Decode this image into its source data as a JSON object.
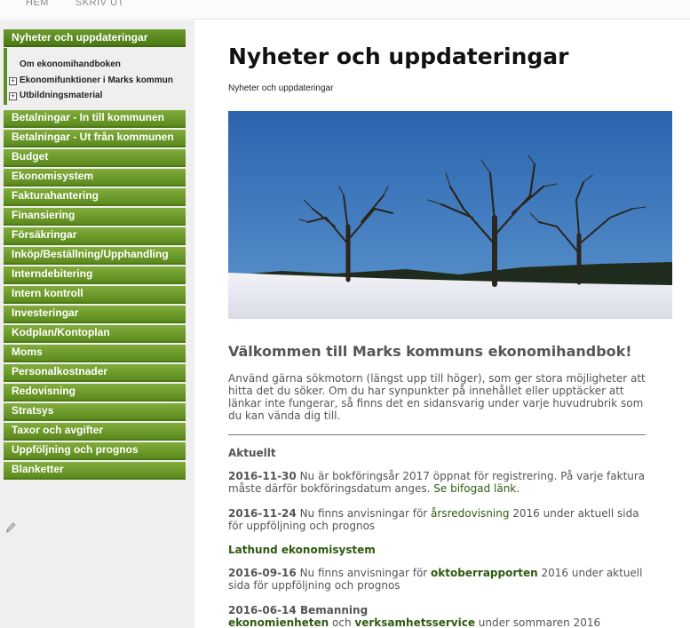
{
  "top_nav": {
    "home": "HEM",
    "print": "SKRIV UT"
  },
  "sidebar": {
    "active_section": "Nyheter och uppdateringar",
    "subitems": [
      {
        "label": "Om ekonomihandboken",
        "expandable": false
      },
      {
        "label": "Ekonomifunktioner i Marks kommun",
        "expandable": true
      },
      {
        "label": "Utbildningsmaterial",
        "expandable": true
      }
    ],
    "items": [
      "Betalningar - In till kommunen",
      "Betalningar - Ut från kommunen",
      "Budget",
      "Ekonomisystem",
      "Fakturahantering",
      "Finansiering",
      "Försäkringar",
      "Inköp/Beställning/Upphandling",
      "Interndebitering",
      "Intern kontroll",
      "Investeringar",
      "Kodplan/Kontoplan",
      "Moms",
      "Personalkostnader",
      "Redovisning",
      "Stratsys",
      "Taxor och avgifter",
      "Uppföljning och prognos",
      "Blanketter"
    ]
  },
  "main": {
    "title": "Nyheter och uppdateringar",
    "breadcrumb": "Nyheter och uppdateringar",
    "welcome_heading": "Välkommen till Marks kommuns ekonomihandbok!",
    "intro": "Använd gärna sökmotorn (längst upp till höger), som ger stora möjligheter att hitta det du söker. Om du har synpunkter på innehållet eller upptäcker att länkar inte fungerar, så finns det en sidansvarig under varje huvudrubrik som du kan vända dig till.",
    "aktuellt_heading": "Aktuellt",
    "news1": {
      "date": "2016-11-30",
      "text": " Nu är bokföringsår 2017 öppnat för registrering. På varje faktura måste därför bokföringsdatum anges. ",
      "link": "Se bifogad länk."
    },
    "news2": {
      "date": "2016-11-24",
      "text_a": " Nu finns anvisningar för ",
      "link": "årsredovisning",
      "text_b": " 2016 under aktuell sida för uppföljning och prognos"
    },
    "lathund_heading": "Lathund ekonomisystem",
    "news3": {
      "date": "2016-09-16",
      "text_a": " Nu finns anvisningar för ",
      "link": "oktoberrapporten",
      "text_b": " 2016 under aktuell sida för uppföljning och prognos"
    },
    "news4": {
      "date": "2016-06-14",
      "title": " Bemanning",
      "link_a": "ekonomienheten",
      "text_a": " och ",
      "link_b": "verksamhetsservice",
      "text_b": " under sommaren 2016"
    }
  },
  "colors": {
    "nav_green": "#6c9a2c",
    "link_green": "#2f5a10",
    "sky": "#2f6fb4"
  }
}
